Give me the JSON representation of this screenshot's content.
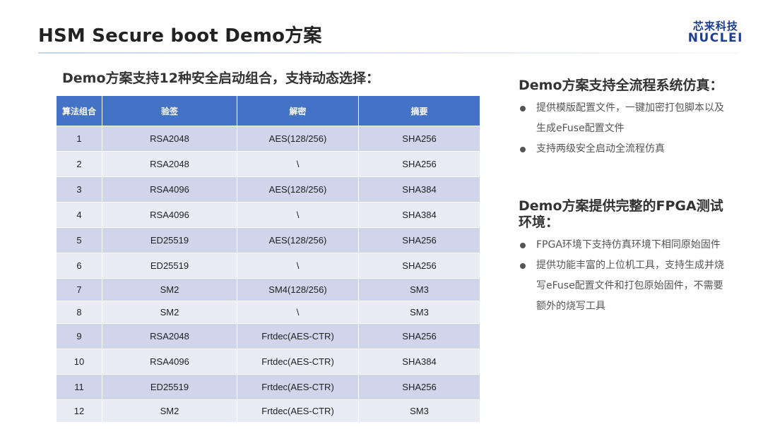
{
  "title": "HSM Secure boot Demo方案",
  "logo": {
    "cn": "芯来科技",
    "en": "NUCLEI"
  },
  "subtitle": "Demo方案支持12种安全启动组合，支持动态选择：",
  "table": {
    "headers": [
      "算法组合",
      "验签",
      "解密",
      "摘要"
    ],
    "rows": [
      [
        "1",
        "RSA2048",
        "AES(128/256)",
        "SHA256"
      ],
      [
        "2",
        "RSA2048",
        "\\",
        "SHA256"
      ],
      [
        "3",
        "RSA4096",
        "AES(128/256)",
        "SHA384"
      ],
      [
        "4",
        "RSA4096",
        "\\",
        "SHA384"
      ],
      [
        "5",
        "ED25519",
        "AES(128/256)",
        "SHA256"
      ],
      [
        "6",
        "ED25519",
        "\\",
        "SHA256"
      ],
      [
        "7",
        "SM2",
        "SM4(128/256)",
        "SM3"
      ],
      [
        "8",
        "SM2",
        "\\",
        "SM3"
      ],
      [
        "9",
        "RSA2048",
        "Frtdec(AES-CTR)",
        "SHA256"
      ],
      [
        "10",
        "RSA4096",
        "Frtdec(AES-CTR)",
        "SHA384"
      ],
      [
        "11",
        "ED25519",
        "Frtdec(AES-CTR)",
        "SHA256"
      ],
      [
        "12",
        "SM2",
        "Frtdec(AES-CTR)",
        "SM3"
      ]
    ]
  },
  "sections": [
    {
      "heading": "Demo方案支持全流程系统仿真：",
      "bullets": [
        "提供模版配置文件，一键加密打包脚本以及生成eFuse配置文件",
        "支持两级安全启动全流程仿真"
      ]
    },
    {
      "heading": "Demo方案提供完整的FPGA测试环境：",
      "bullets": [
        "FPGA环境下支持仿真环境下相同原始固件",
        "提供功能丰富的上位机工具，支持生成并烧写eFuse配置文件和打包原始固件，不需要额外的烧写工具"
      ]
    }
  ]
}
